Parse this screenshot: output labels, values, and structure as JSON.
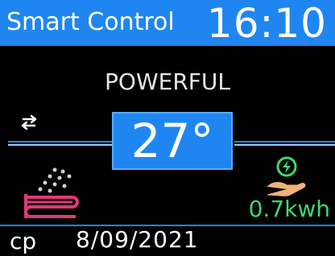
{
  "header": {
    "title": "Smart Control",
    "time": "16:10"
  },
  "main": {
    "mode": "POWERFUL",
    "set_temperature": "27°",
    "energy": "0.7kwh"
  },
  "footer": {
    "user": "cp",
    "date": "8/09/2021"
  },
  "icons": {
    "swap": "swap-arrows-icon",
    "heater": "heater-spray-icon",
    "energy": "energy-hand-icon"
  },
  "colors": {
    "accent": "#1f86f1",
    "background": "#000000",
    "energy_green": "#40d86a",
    "heater_pink": "#e0397a"
  }
}
